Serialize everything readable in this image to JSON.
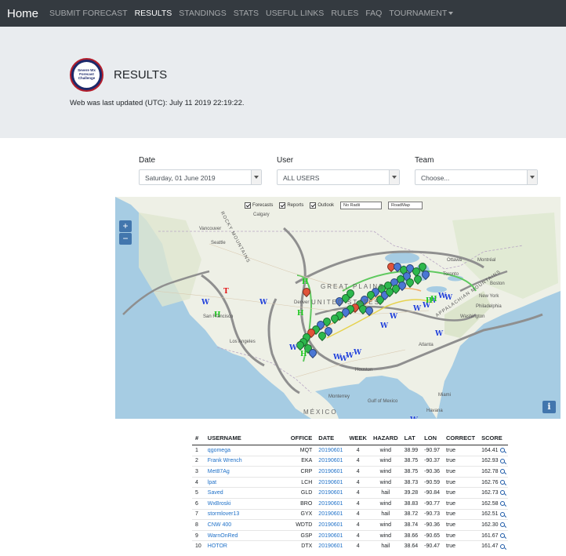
{
  "nav": {
    "brand": "Home",
    "items": [
      {
        "label": "SUBMIT FORECAST",
        "active": false
      },
      {
        "label": "RESULTS",
        "active": true
      },
      {
        "label": "STANDINGS",
        "active": false
      },
      {
        "label": "STATS",
        "active": false
      },
      {
        "label": "USEFUL LINKS",
        "active": false
      },
      {
        "label": "RULES",
        "active": false
      },
      {
        "label": "FAQ",
        "active": false
      },
      {
        "label": "TOURNAMENT",
        "active": false,
        "dropdown": true
      }
    ]
  },
  "header": {
    "logo_text": "Severe Wx Forecast Challenge",
    "title": "RESULTS",
    "updated": "Web was last updated (UTC): July 11 2019 22:19:22."
  },
  "filters": {
    "date": {
      "label": "Date",
      "value": "Saturday, 01 June 2019"
    },
    "user": {
      "label": "User",
      "value": "ALL USERS"
    },
    "team": {
      "label": "Team",
      "value": "Choose..."
    }
  },
  "map": {
    "controls": {
      "forecasts": "Forecasts",
      "reports": "Reports",
      "outlook": "Outlook",
      "radii": "No Radii",
      "maptype": "RoadMap"
    },
    "zoom_in": "+",
    "zoom_out": "−",
    "info": "i",
    "labels": {
      "calgary": "Calgary",
      "vancouver": "Vancouver",
      "seattle": "Seattle",
      "san_francisco": "San Francisco",
      "los_angeles": "Los Angeles",
      "denver": "Denver",
      "houston": "Houston",
      "monterrey": "Monterrey",
      "mexico": "MÉXICO",
      "gulf": "Gulf of Mexico",
      "great_plains": "GREAT PLAINS",
      "united_states": "UNITED STATES",
      "atlanta": "Atlanta",
      "miami": "Miami",
      "havana": "Havana",
      "washington": "Washington",
      "philadelphia": "Philadelphia",
      "new_york": "New York",
      "boston": "Boston",
      "toronto": "Toronto",
      "ottawa": "Ottawa",
      "montreal": "Montréal",
      "appalachian": "APPALACHIAN MOUNTAINS",
      "rocky": "ROCKY MOUNTAINS"
    }
  },
  "table": {
    "headers": [
      "#",
      "USERNAME",
      "OFFICE",
      "DATE",
      "WEEK",
      "HAZARD",
      "LAT",
      "LON",
      "CORRECT",
      "SCORE"
    ],
    "rows": [
      [
        "1",
        "qgomega",
        "MQT",
        "20190601",
        "4",
        "wind",
        "38.99",
        "-90.97",
        "true",
        "164.41"
      ],
      [
        "2",
        "Frank Wrench",
        "EKA",
        "20190601",
        "4",
        "wind",
        "38.75",
        "-90.37",
        "true",
        "162.93"
      ],
      [
        "3",
        "Met87Ag",
        "CRP",
        "20190601",
        "4",
        "wind",
        "38.75",
        "-90.36",
        "true",
        "162.78"
      ],
      [
        "4",
        "lpat",
        "LCH",
        "20190601",
        "4",
        "wind",
        "38.73",
        "-90.59",
        "true",
        "162.76"
      ],
      [
        "5",
        "Saved",
        "GLD",
        "20190601",
        "4",
        "hail",
        "39.28",
        "-90.84",
        "true",
        "162.73"
      ],
      [
        "6",
        "WxBroski",
        "BRO",
        "20190601",
        "4",
        "wind",
        "38.83",
        "-90.77",
        "true",
        "162.58"
      ],
      [
        "7",
        "stormlover13",
        "GYX",
        "20190601",
        "4",
        "hail",
        "38.72",
        "-90.73",
        "true",
        "162.51"
      ],
      [
        "8",
        "CNW 400",
        "WDTD",
        "20190601",
        "4",
        "wind",
        "38.74",
        "-90.36",
        "true",
        "162.30"
      ],
      [
        "9",
        "WarnOnRed",
        "GSP",
        "20190601",
        "4",
        "wind",
        "38.66",
        "-90.65",
        "true",
        "161.67"
      ],
      [
        "10",
        "HOTOR",
        "DTX",
        "20190601",
        "4",
        "hail",
        "38.64",
        "-90.47",
        "true",
        "161.47"
      ]
    ]
  },
  "colors": {
    "navbar": "#343a40",
    "jumbotron": "#e9ecef",
    "link": "#1e70c8",
    "pin_green": "#2db84d",
    "pin_blue": "#4a77d4",
    "pin_red": "#e0533a",
    "report_wind": "#1f3fd8",
    "report_hail": "#19c419",
    "report_tornado": "#e01010"
  }
}
